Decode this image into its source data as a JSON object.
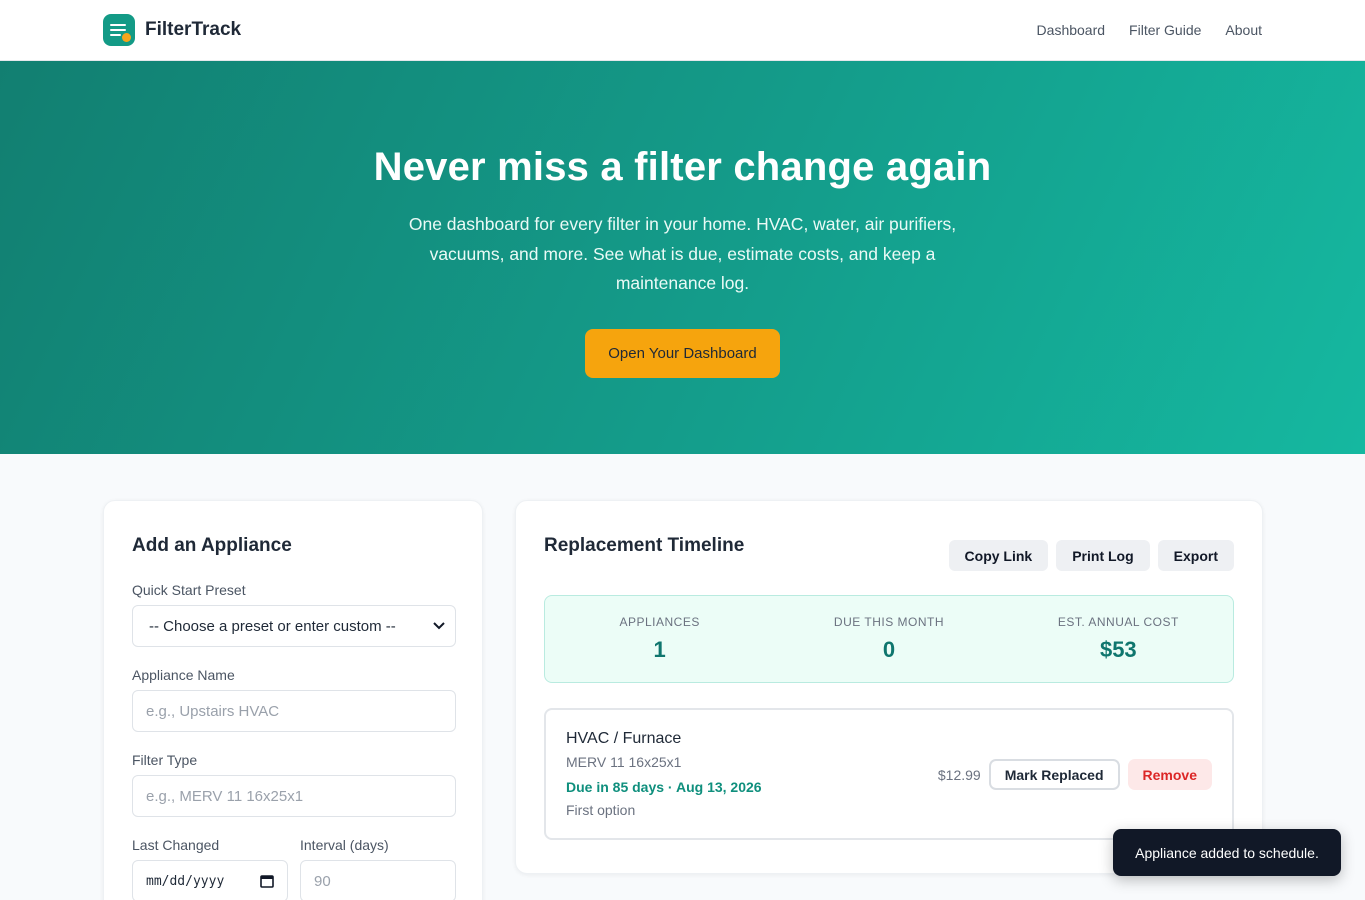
{
  "brand": {
    "name": "FilterTrack",
    "logo_icon": "filter-list-icon",
    "accent": "#139a86"
  },
  "nav": {
    "items": [
      "Dashboard",
      "Filter Guide",
      "About"
    ]
  },
  "hero": {
    "title": "Never miss a filter change again",
    "subtitle": "One dashboard for every filter in your home. HVAC, water, air purifiers, vacuums, and more. See what is due, estimate costs, and keep a maintenance log.",
    "cta_label": "Open Your Dashboard",
    "cta_color": "#f6a40d"
  },
  "form": {
    "title": "Add an Appliance",
    "preset_label": "Quick Start Preset",
    "preset_value": "-- Choose a preset or enter custom --",
    "name_label": "Appliance Name",
    "name_placeholder": "e.g., Upstairs HVAC",
    "filter_label": "Filter Type",
    "filter_placeholder": "e.g., MERV 11 16x25x1",
    "last_changed_label": "Last Changed",
    "last_changed_value": "mm/dd/yyyy",
    "interval_label": "Interval (days)",
    "interval_placeholder": "90"
  },
  "timeline": {
    "title": "Replacement Timeline",
    "actions": [
      "Copy Link",
      "Print Log",
      "Export"
    ],
    "stats": [
      {
        "label": "APPLIANCES",
        "value": "1"
      },
      {
        "label": "DUE THIS MONTH",
        "value": "0"
      },
      {
        "label": "EST. ANNUAL COST",
        "value": "$53"
      }
    ],
    "items": [
      {
        "name": "HVAC / Furnace",
        "filter": "MERV 11 16x25x1",
        "due": "Due in 85 days · Aug 13, 2026",
        "note": "First option",
        "price": "$12.99",
        "replace_label": "Mark Replaced",
        "remove_label": "Remove"
      }
    ]
  },
  "toast": {
    "message": "Appliance added to schedule."
  }
}
